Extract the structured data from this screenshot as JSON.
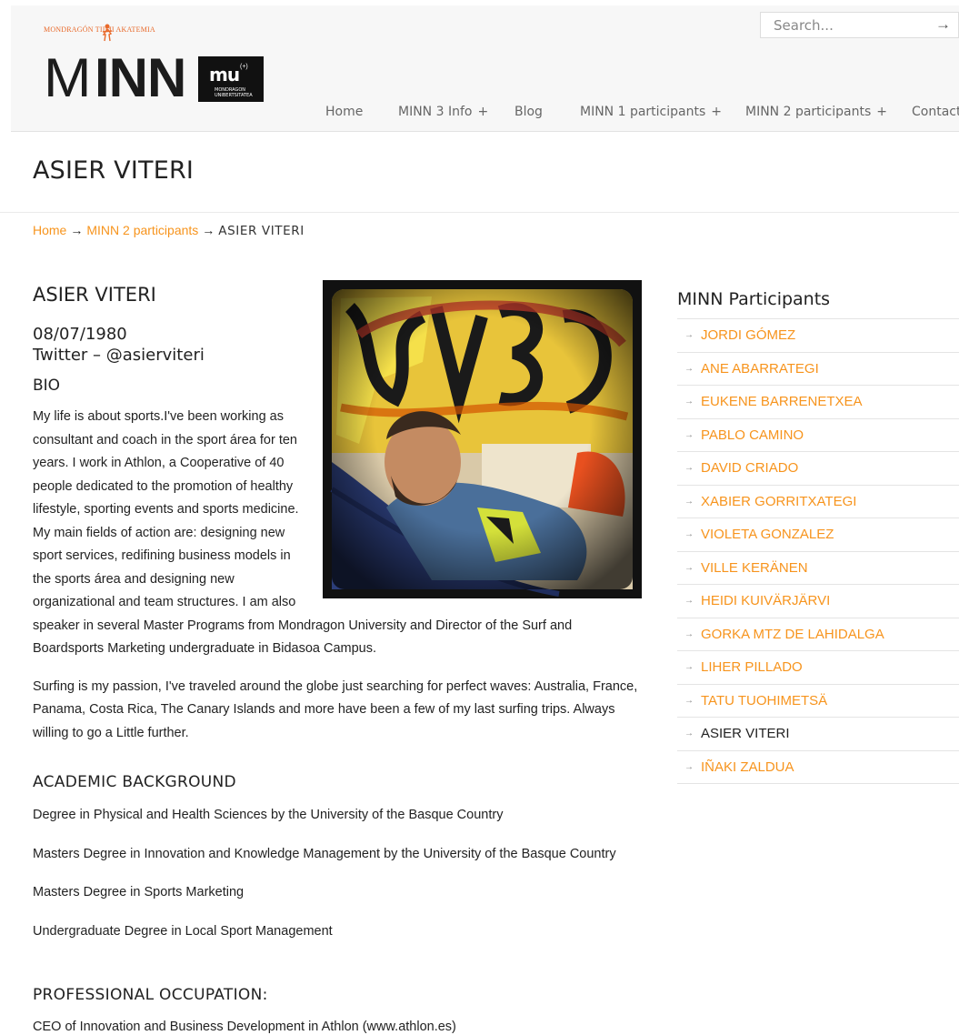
{
  "header": {
    "logo_top_text": "MONDRAGÓN TIIMI AKATEMIA",
    "logo_m": "M",
    "logo_inn": "INN",
    "logo_mu": "mu",
    "logo_mu_sup": "(+)",
    "logo_mu_sub1": "MONDRAGON",
    "logo_mu_sub2": "UNIBERTSITATEA",
    "search_placeholder": "Search...",
    "search_arrow": "→"
  },
  "nav": {
    "home": "Home",
    "minn3": "MINN 3 Info",
    "blog": "Blog",
    "minn1": "MINN 1 participants",
    "minn2": "MINN 2 participants",
    "contact": "Contact",
    "plus": "+"
  },
  "page_title": "ASIER VITERI",
  "breadcrumb": {
    "home": "Home",
    "parent": "MINN 2 participants",
    "current": "ASIER VITERI",
    "sep": "→"
  },
  "profile": {
    "name": "ASIER VITERI",
    "dob": "08/07/1980",
    "twitter": "Twitter – @asierviteri",
    "bio_head": "BIO",
    "bio_p1": "My life is about sports.I've been working as consultant and coach in the sport área for ten years. I work in Athlon, a Cooperative of 40 people dedicated to the promotion of healthy lifestyle, sporting events and sports medicine. My main fields of action are: designing new sport services, redifining business models in the sports área and designing new organizational and team structures. I am also speaker in several Master Programs from Mondragon University and Director of the Surf and Boardsports Marketing undergraduate in Bidasoa Campus.",
    "bio_p2": "Surfing is my passion, I've traveled around the globe just searching for perfect waves: Australia, France, Panama, Costa Rica, The Canary Islands and more have been a few of my last surfing trips. Always willing to go a Little further.",
    "academic_head": "ACADEMIC BACKGROUND",
    "academic": [
      "Degree in Physical and Health Sciences by the University of the Basque Country",
      "Masters Degree in Innovation and Knowledge Management by the University of the Basque Country",
      "Masters Degree in Sports Marketing",
      "Undergraduate Degree in Local Sport Management"
    ],
    "prof_head": "PROFESSIONAL OCCUPATION:",
    "prof_text": "CEO of Innovation and Business Development in Athlon (www.athlon.es)"
  },
  "sidebar": {
    "title": "MINN Participants",
    "arrow": "→",
    "items": [
      "JORDI GÓMEZ",
      "ANE ABARRATEGI",
      "EUKENE BARRENETXEA",
      "PABLO CAMINO",
      "DAVID CRIADO",
      "XABIER GORRITXATEGI",
      "VIOLETA GONZALEZ",
      "VILLE KERÄNEN",
      "HEIDI KUIVÄRJÄRVI",
      "GORKA MTZ DE LAHIDALGA",
      "LIHER PILLADO",
      "TATU TUOHIMETSÄ",
      "ASIER VITERI",
      "IÑAKI ZALDUA"
    ]
  },
  "colors": {
    "accent": "#f7941d",
    "text": "#222222",
    "header_bg": "#f7f7f7"
  }
}
